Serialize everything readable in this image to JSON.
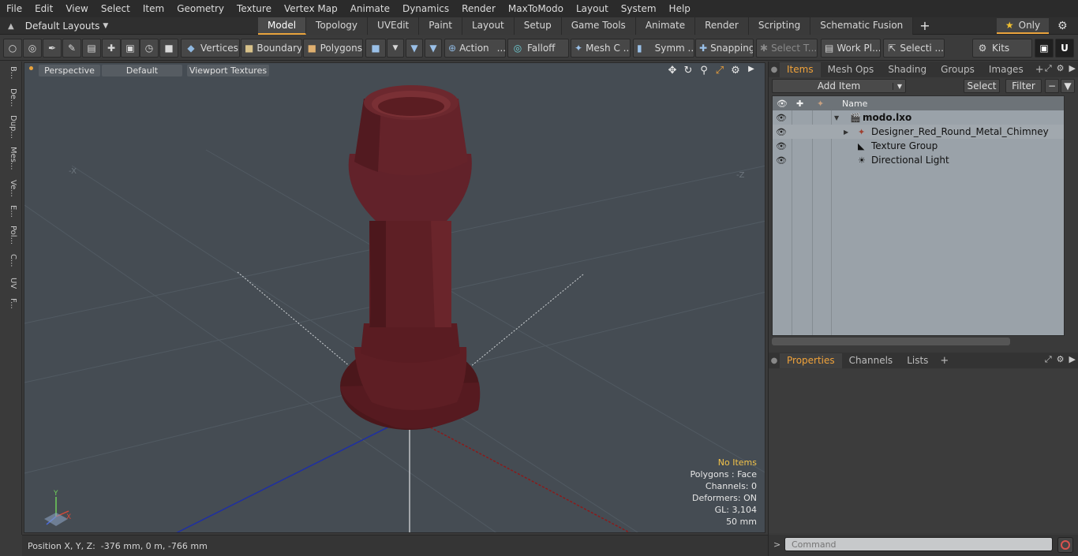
{
  "menu": [
    "File",
    "Edit",
    "View",
    "Select",
    "Item",
    "Geometry",
    "Texture",
    "Vertex Map",
    "Animate",
    "Dynamics",
    "Render",
    "MaxToModo",
    "Layout",
    "System",
    "Help"
  ],
  "layouts_dropdown": "Default Layouts",
  "layout_tabs": [
    "Model",
    "Topology",
    "UVEdit",
    "Paint",
    "Layout",
    "Setup",
    "Game Tools",
    "Animate",
    "Render",
    "Scripting",
    "Schematic Fusion"
  ],
  "active_layout_tab": "Model",
  "only_label": "Only",
  "toolbar": {
    "vertices": "Vertices",
    "boundary": "Boundary",
    "polygons": "Polygons",
    "action": "Action",
    "falloff": "Falloff",
    "mesh": "Mesh C ...",
    "symm": "Symm ...",
    "snapping": "Snapping",
    "select_t": "Select T...",
    "work_pl": "Work Pl...",
    "selecti": "Selecti ...",
    "kits": "Kits",
    "ellipsis": "..."
  },
  "left_strip": [
    "B...",
    "De...",
    "Dup...",
    "Mes...",
    "Ve...",
    "E...",
    "Pol...",
    "C...",
    "UV",
    "F..."
  ],
  "viewport": {
    "view_mode": "Perspective",
    "shading": "Default",
    "textures": "Viewport Textures",
    "axis_neg_x": "-X",
    "axis_neg_z": "-Z",
    "gizmo_x": "X",
    "gizmo_y": "Y",
    "stats": {
      "selection": "No Items",
      "polygons": "Polygons : Face",
      "channels": "Channels: 0",
      "deformers": "Deformers: ON",
      "gl": "GL: 3,104",
      "grid": "50 mm"
    },
    "colors": {
      "background": "#454c53",
      "model": "#5c1f24",
      "x_axis": "#8b1a1a",
      "z_axis": "#1f2fa0"
    }
  },
  "status_bar": "Position X, Y, Z:  -376 mm, 0 m, -766 mm",
  "items_panel": {
    "tabs": [
      "Items",
      "Mesh Ops",
      "Shading",
      "Groups",
      "Images"
    ],
    "active_tab": "Items",
    "add_item": "Add Item",
    "select": "Select",
    "filter": "Filter",
    "name_header": "Name",
    "tree": [
      {
        "label": "modo.lxo",
        "indent": 0
      },
      {
        "label": "Designer_Red_Round_Metal_Chimney",
        "indent": 1
      },
      {
        "label": "Texture Group",
        "indent": 1
      },
      {
        "label": "Directional Light",
        "indent": 1
      }
    ]
  },
  "properties_panel": {
    "tabs": [
      "Properties",
      "Channels",
      "Lists"
    ],
    "active_tab": "Properties"
  },
  "command_placeholder": "Command",
  "command_prompt": ">"
}
